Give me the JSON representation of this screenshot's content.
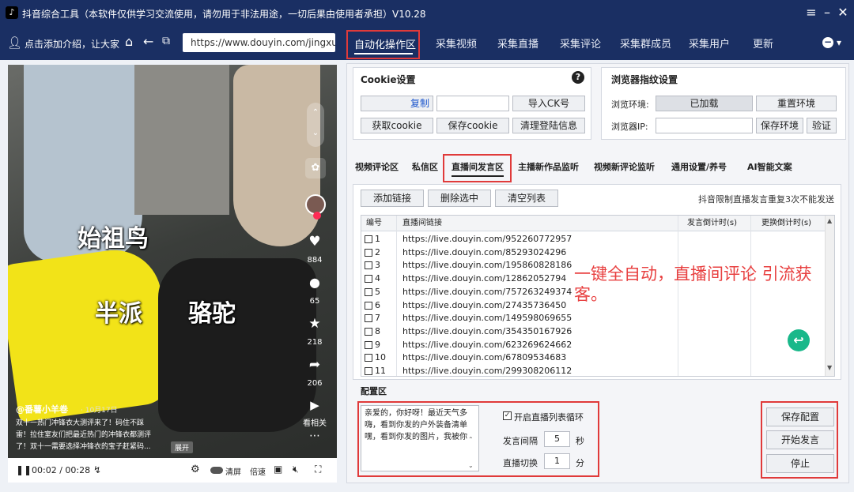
{
  "window": {
    "title": "抖音综合工具（本软件仅供学习交流使用，请勿用于非法用途，一切后果由使用者承担）V10.28"
  },
  "nav": {
    "profile_text": "点击添加介绍，让大家认",
    "url": "https://www.douyin.com/jingxuan",
    "tabs": [
      "自动化操作区",
      "采集视频",
      "采集直播",
      "采集评论",
      "采集群成员",
      "采集用户",
      "更新"
    ]
  },
  "video": {
    "label_title": "始祖鸟",
    "label_left": "半派",
    "label_right": "骆驼",
    "likes": "884",
    "comments": "65",
    "favorites": "218",
    "shares": "206",
    "more_label": "看相关",
    "author": "@番薯小羊卷",
    "date": "· 10月17日",
    "desc": [
      "双十一热门冲锋衣大测评来了！码住不踩",
      "雷！拉住室友们把最近热门的冲锋衣都测评",
      "了！双十一需要选择冲锋衣的宝子赶紧码..."
    ],
    "expand": "展开",
    "time": "00:02 / 00:28",
    "speed_label": "清屏",
    "speed2": "倍速"
  },
  "cookie": {
    "title": "Cookie设置",
    "copy": "复制",
    "import": "导入CK号",
    "get": "获取cookie",
    "save": "保存cookie",
    "clear": "清理登陆信息"
  },
  "fingerprint": {
    "title": "浏览器指纹设置",
    "env_label": "浏览环境:",
    "env_value": "已加载",
    "reset": "重置环境",
    "ip_label": "浏览器IP:",
    "save_env": "保存环境",
    "verify": "验证"
  },
  "subtabs": [
    "视频评论区",
    "私信区",
    "直播间发言区",
    "主播新作品监听",
    "视频新评论监听",
    "通用设置/养号",
    "AI智能文案"
  ],
  "list": {
    "add": "添加链接",
    "delete": "删除选中",
    "clear": "清空列表",
    "note": "抖音限制直播发言重复3次不能发送",
    "headers": [
      "编号",
      "直播间链接",
      "发言倒计时(s)",
      "更换倒计时(s)"
    ],
    "rows": [
      [
        "1",
        "https://live.douyin.com/952260772957"
      ],
      [
        "2",
        "https://live.douyin.com/85293024296"
      ],
      [
        "3",
        "https://live.douyin.com/195860828186"
      ],
      [
        "4",
        "https://live.douyin.com/12862052794"
      ],
      [
        "5",
        "https://live.douyin.com/757263249374"
      ],
      [
        "6",
        "https://live.douyin.com/27435736450"
      ],
      [
        "7",
        "https://live.douyin.com/149598069655"
      ],
      [
        "8",
        "https://live.douyin.com/354350167926"
      ],
      [
        "9",
        "https://live.douyin.com/623269624662"
      ],
      [
        "10",
        "https://live.douyin.com/67809534683"
      ],
      [
        "11",
        "https://live.douyin.com/299308206112"
      ]
    ]
  },
  "overlay": {
    "line1": "一键全自动，直播间评论 引流获",
    "line2": "客。"
  },
  "config": {
    "title": "配置区",
    "message": "亲爱的，你好呀！最近天气多嗨，看到你发的户外装备清单嘿，看到你发的图片，我被你",
    "loop_label": "开启直播列表循环",
    "interval_label": "发言间隔",
    "interval_value": "5",
    "interval_unit": "秒",
    "switch_label": "直播切换",
    "switch_value": "1",
    "switch_unit": "分"
  },
  "actions": {
    "save": "保存配置",
    "start": "开始发言",
    "stop": "停止"
  }
}
